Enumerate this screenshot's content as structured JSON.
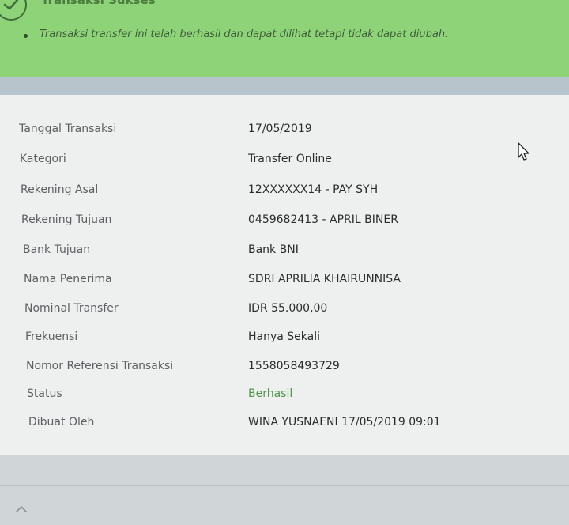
{
  "banner": {
    "title": "Transaksi Sukses",
    "message": "Transaksi transfer ini telah berhasil dan dapat dilihat tetapi tidak dapat diubah.",
    "icon": "check-circle-icon",
    "color": "#8ed378"
  },
  "details": [
    {
      "label": "Tanggal Transaksi",
      "value": "17/05/2019"
    },
    {
      "label": "Kategori",
      "value": "Transfer Online"
    },
    {
      "label": "Rekening Asal",
      "value": "12XXXXXX14 - PAY SYH"
    },
    {
      "label": "Rekening Tujuan",
      "value": "0459682413 - APRIL BINER"
    },
    {
      "label": "Bank Tujuan",
      "value": "Bank BNI"
    },
    {
      "label": "Nama Penerima",
      "value": "SDRI APRILIA KHAIRUNNISA"
    },
    {
      "label": "Nominal Transfer",
      "value": "IDR 55.000,00"
    },
    {
      "label": "Frekuensi",
      "value": "Hanya Sekali"
    },
    {
      "label": "Nomor Referensi Transaksi",
      "value": "1558058493729"
    },
    {
      "label": "Status",
      "value": "Berhasil"
    },
    {
      "label": "Dibuat Oleh",
      "value": "WINA YUSNAENI   17/05/2019 09:01"
    }
  ],
  "status_color": "#4f9648",
  "footer": {
    "icon": "chevron-up-icon"
  }
}
